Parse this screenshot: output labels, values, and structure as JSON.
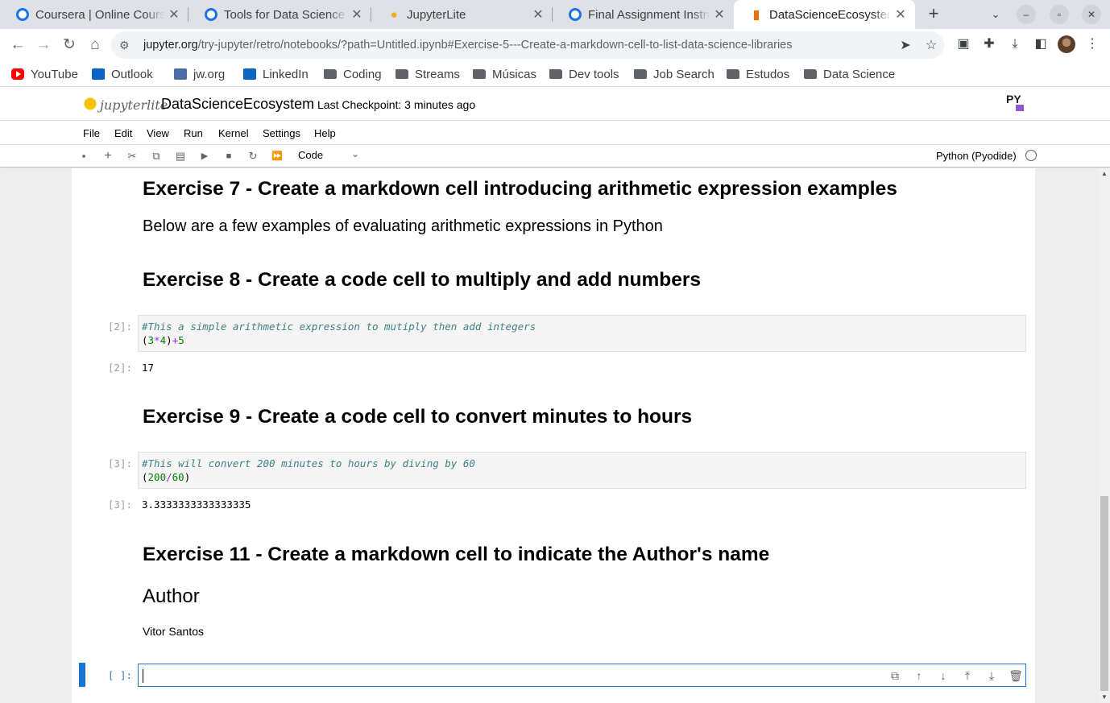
{
  "browser": {
    "tabs": [
      {
        "title": "Coursera | Online Courses",
        "icon": "coursera-icon"
      },
      {
        "title": "Tools for Data Science - Final",
        "icon": "coursera-icon"
      },
      {
        "title": "JupyterLite",
        "icon": "jupyterlite-icon"
      },
      {
        "title": "Final Assignment Instructions",
        "icon": "coursera-icon"
      },
      {
        "title": "DataScienceEcosystem",
        "icon": "notebook-icon"
      }
    ],
    "url_host": "jupyter.org",
    "url_path": "/try-jupyter/retro/notebooks/?path=Untitled.ipynb#Exercise-5---Create-a-markdown-cell-to-list-data-science-libraries",
    "bookmarks": [
      "YouTube",
      "Outlook",
      "jw.org",
      "LinkedIn",
      "Coding",
      "Streams",
      "Músicas",
      "Dev tools",
      "Job Search",
      "Estudos",
      "Data Science"
    ]
  },
  "jupyter": {
    "logo_text": "jupyterlite",
    "notebook_name": "DataScienceEcosystem",
    "checkpoint": "Last Checkpoint: 3 minutes ago",
    "menu": [
      "File",
      "Edit",
      "View",
      "Run",
      "Kernel",
      "Settings",
      "Help"
    ],
    "cell_type": "Code",
    "kernel_name": "Python (Pyodide)"
  },
  "notebook": {
    "ex7_heading": "Exercise 7 - Create a markdown cell introducing arithmetic expression examples",
    "ex7_text": "Below are a few examples of evaluating arithmetic expressions in Python",
    "ex8_heading": "Exercise 8 - Create a code cell to multiply and add numbers",
    "cell2": {
      "in_prompt": "[2]:",
      "comment": "#This a simple arithmetic expression to mutiply then add integers",
      "code_parts": [
        "(",
        "3",
        "*",
        "4",
        ")",
        "+",
        "5"
      ],
      "out_prompt": "[2]:",
      "output": "17"
    },
    "ex9_heading": "Exercise 9 - Create a code cell to convert minutes to hours",
    "cell3": {
      "in_prompt": "[3]:",
      "comment": "#This will convert 200 minutes to hours by diving by 60",
      "code_parts": [
        "(",
        "200",
        "/",
        "60",
        ")"
      ],
      "out_prompt": "[3]:",
      "output": "3.3333333333333335"
    },
    "ex11_heading": "Exercise 11 - Create a markdown cell to indicate the Author's name",
    "author_heading": "Author",
    "author_name": "Vitor Santos",
    "empty_prompt": "[ ]:"
  }
}
